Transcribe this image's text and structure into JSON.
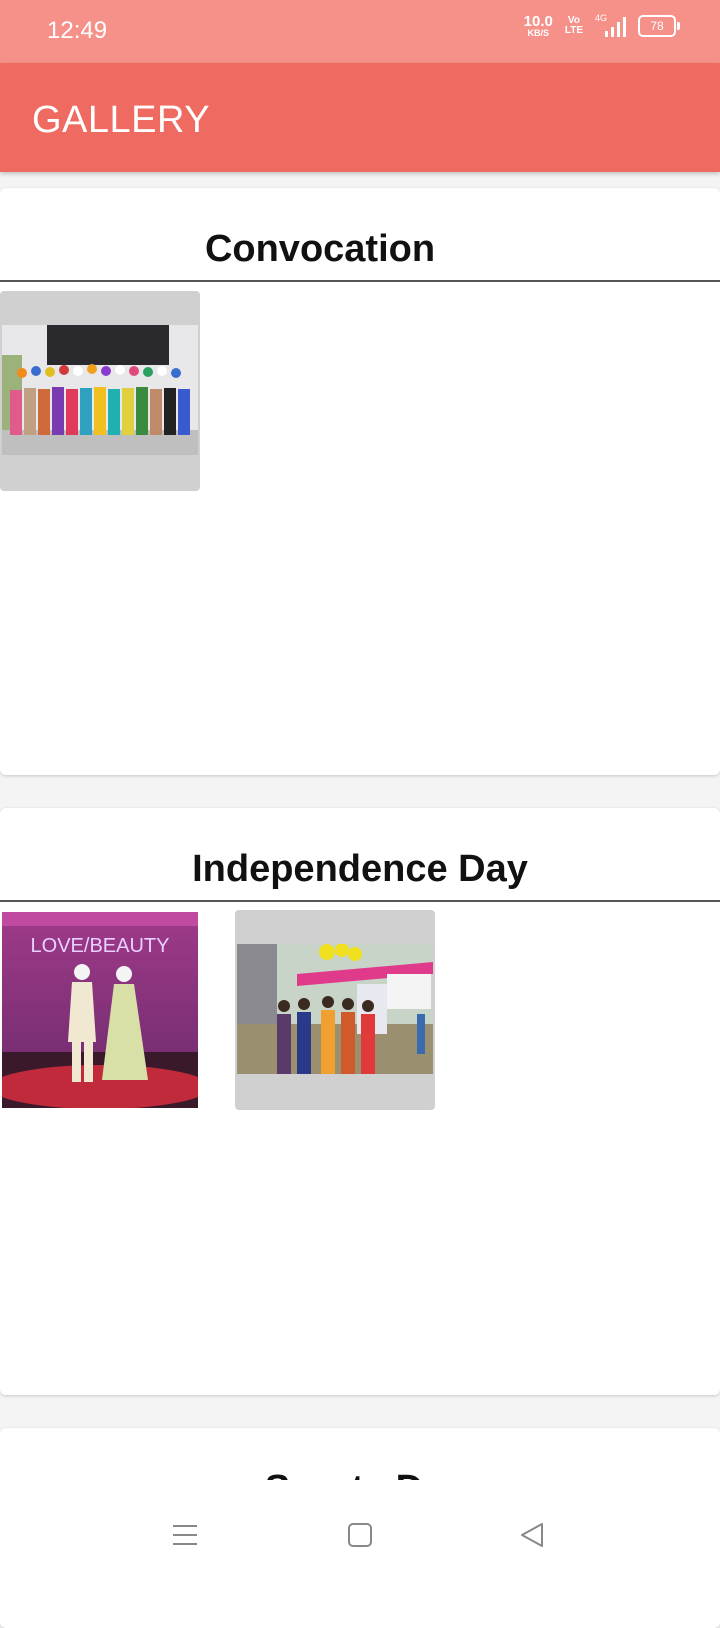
{
  "status": {
    "time": "12:49",
    "speed_value": "10.0",
    "speed_unit": "KB/S",
    "volte_top": "Vo",
    "volte_bottom": "LTE",
    "network": "4G",
    "battery": "78"
  },
  "app_bar": {
    "title": "GALLERY"
  },
  "sections": [
    {
      "title": "Convocation",
      "images": [
        "convocation-group-photo"
      ]
    },
    {
      "title": "Independence Day",
      "images": [
        "love-beauty-stage-performance",
        "outdoor-celebration-photo"
      ]
    },
    {
      "title": "Sports Day"
    }
  ],
  "thumbnail_overlay_text": "LOVE/BEAUTY",
  "nav": {
    "icons": [
      "menu-icon",
      "home-square-icon",
      "back-triangle-icon"
    ]
  }
}
